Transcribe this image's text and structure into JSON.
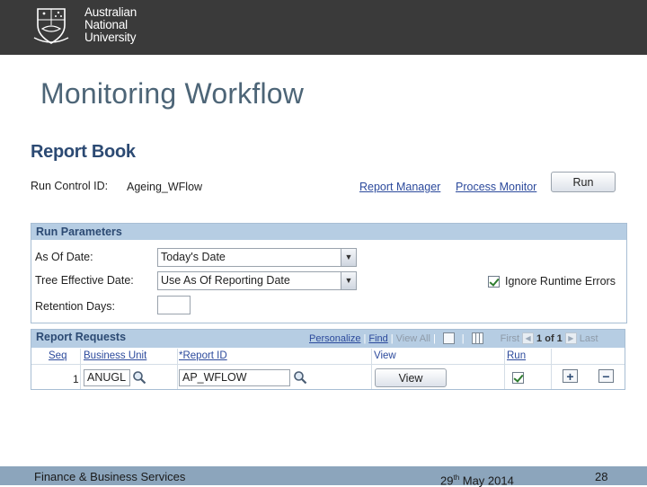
{
  "header": {
    "university_name": "Australian National University",
    "university_lines": [
      "Australian",
      "National",
      "University"
    ]
  },
  "slide": {
    "title": "Monitoring Workflow"
  },
  "page": {
    "title": "Report Book",
    "run_control_label": "Run Control ID:",
    "run_control_value": "Ageing_WFlow",
    "report_manager_link": "Report Manager",
    "process_monitor_link": "Process Monitor",
    "run_button": "Run"
  },
  "run_parameters": {
    "heading": "Run Parameters",
    "as_of_date_label": "As Of Date:",
    "as_of_date_value": "Today's Date",
    "tree_effective_label": "Tree Effective Date:",
    "tree_effective_value": "Use As Of Reporting Date",
    "retention_label": "Retention Days:",
    "retention_value": "",
    "ignore_errors_label": "Ignore Runtime Errors",
    "ignore_errors_checked": true
  },
  "report_requests": {
    "heading": "Report Requests",
    "toolbar": {
      "personalize": "Personalize",
      "find": "Find",
      "view_all": "View All",
      "first": "First",
      "counter": "1 of 1",
      "last": "Last"
    },
    "columns": [
      "Seq",
      "Business Unit",
      "*Report ID",
      "View",
      "Run"
    ],
    "rows": [
      {
        "seq": "1",
        "business_unit": "ANUGL",
        "report_id": "AP_WFLOW",
        "view_button": "View",
        "run_checked": true
      }
    ],
    "add_row": "+",
    "delete_row": "−"
  },
  "footer": {
    "left": "Finance & Business Services",
    "date_day": "29",
    "date_suffix": "th",
    "date_rest": " May 2014",
    "page_number": "28"
  },
  "colors": {
    "header_bg": "#3a3a3a",
    "slide_title": "#4d6577",
    "section_bar": "#b6cde3",
    "link": "#2c4a9c",
    "footer_bg": "#8ca5bc"
  }
}
